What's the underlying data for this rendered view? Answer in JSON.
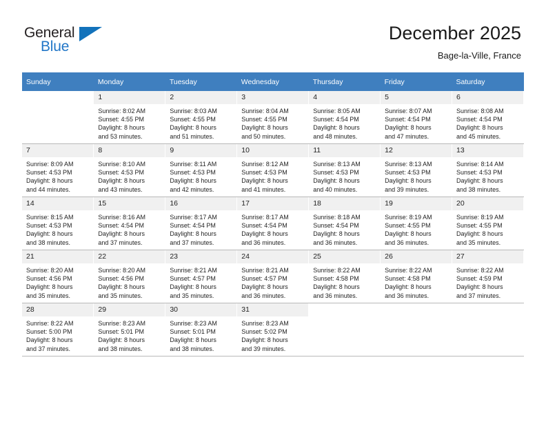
{
  "brand": {
    "name_top": "General",
    "name_bottom": "Blue",
    "accent_color": "#1272bb",
    "text_color": "#231f20"
  },
  "header": {
    "month_title": "December 2025",
    "location": "Bage-la-Ville, France"
  },
  "calendar": {
    "header_bg": "#3f7fbf",
    "weekdays": [
      "Sunday",
      "Monday",
      "Tuesday",
      "Wednesday",
      "Thursday",
      "Friday",
      "Saturday"
    ],
    "weeks": [
      [
        {
          "day": "",
          "sunrise": "",
          "sunset": "",
          "daylight1": "",
          "daylight2": "",
          "blank": true
        },
        {
          "day": "1",
          "sunrise": "Sunrise: 8:02 AM",
          "sunset": "Sunset: 4:55 PM",
          "daylight1": "Daylight: 8 hours",
          "daylight2": "and 53 minutes."
        },
        {
          "day": "2",
          "sunrise": "Sunrise: 8:03 AM",
          "sunset": "Sunset: 4:55 PM",
          "daylight1": "Daylight: 8 hours",
          "daylight2": "and 51 minutes."
        },
        {
          "day": "3",
          "sunrise": "Sunrise: 8:04 AM",
          "sunset": "Sunset: 4:55 PM",
          "daylight1": "Daylight: 8 hours",
          "daylight2": "and 50 minutes."
        },
        {
          "day": "4",
          "sunrise": "Sunrise: 8:05 AM",
          "sunset": "Sunset: 4:54 PM",
          "daylight1": "Daylight: 8 hours",
          "daylight2": "and 48 minutes."
        },
        {
          "day": "5",
          "sunrise": "Sunrise: 8:07 AM",
          "sunset": "Sunset: 4:54 PM",
          "daylight1": "Daylight: 8 hours",
          "daylight2": "and 47 minutes."
        },
        {
          "day": "6",
          "sunrise": "Sunrise: 8:08 AM",
          "sunset": "Sunset: 4:54 PM",
          "daylight1": "Daylight: 8 hours",
          "daylight2": "and 45 minutes."
        }
      ],
      [
        {
          "day": "7",
          "sunrise": "Sunrise: 8:09 AM",
          "sunset": "Sunset: 4:53 PM",
          "daylight1": "Daylight: 8 hours",
          "daylight2": "and 44 minutes."
        },
        {
          "day": "8",
          "sunrise": "Sunrise: 8:10 AM",
          "sunset": "Sunset: 4:53 PM",
          "daylight1": "Daylight: 8 hours",
          "daylight2": "and 43 minutes."
        },
        {
          "day": "9",
          "sunrise": "Sunrise: 8:11 AM",
          "sunset": "Sunset: 4:53 PM",
          "daylight1": "Daylight: 8 hours",
          "daylight2": "and 42 minutes."
        },
        {
          "day": "10",
          "sunrise": "Sunrise: 8:12 AM",
          "sunset": "Sunset: 4:53 PM",
          "daylight1": "Daylight: 8 hours",
          "daylight2": "and 41 minutes."
        },
        {
          "day": "11",
          "sunrise": "Sunrise: 8:13 AM",
          "sunset": "Sunset: 4:53 PM",
          "daylight1": "Daylight: 8 hours",
          "daylight2": "and 40 minutes."
        },
        {
          "day": "12",
          "sunrise": "Sunrise: 8:13 AM",
          "sunset": "Sunset: 4:53 PM",
          "daylight1": "Daylight: 8 hours",
          "daylight2": "and 39 minutes."
        },
        {
          "day": "13",
          "sunrise": "Sunrise: 8:14 AM",
          "sunset": "Sunset: 4:53 PM",
          "daylight1": "Daylight: 8 hours",
          "daylight2": "and 38 minutes."
        }
      ],
      [
        {
          "day": "14",
          "sunrise": "Sunrise: 8:15 AM",
          "sunset": "Sunset: 4:53 PM",
          "daylight1": "Daylight: 8 hours",
          "daylight2": "and 38 minutes."
        },
        {
          "day": "15",
          "sunrise": "Sunrise: 8:16 AM",
          "sunset": "Sunset: 4:54 PM",
          "daylight1": "Daylight: 8 hours",
          "daylight2": "and 37 minutes."
        },
        {
          "day": "16",
          "sunrise": "Sunrise: 8:17 AM",
          "sunset": "Sunset: 4:54 PM",
          "daylight1": "Daylight: 8 hours",
          "daylight2": "and 37 minutes."
        },
        {
          "day": "17",
          "sunrise": "Sunrise: 8:17 AM",
          "sunset": "Sunset: 4:54 PM",
          "daylight1": "Daylight: 8 hours",
          "daylight2": "and 36 minutes."
        },
        {
          "day": "18",
          "sunrise": "Sunrise: 8:18 AM",
          "sunset": "Sunset: 4:54 PM",
          "daylight1": "Daylight: 8 hours",
          "daylight2": "and 36 minutes."
        },
        {
          "day": "19",
          "sunrise": "Sunrise: 8:19 AM",
          "sunset": "Sunset: 4:55 PM",
          "daylight1": "Daylight: 8 hours",
          "daylight2": "and 36 minutes."
        },
        {
          "day": "20",
          "sunrise": "Sunrise: 8:19 AM",
          "sunset": "Sunset: 4:55 PM",
          "daylight1": "Daylight: 8 hours",
          "daylight2": "and 35 minutes."
        }
      ],
      [
        {
          "day": "21",
          "sunrise": "Sunrise: 8:20 AM",
          "sunset": "Sunset: 4:56 PM",
          "daylight1": "Daylight: 8 hours",
          "daylight2": "and 35 minutes."
        },
        {
          "day": "22",
          "sunrise": "Sunrise: 8:20 AM",
          "sunset": "Sunset: 4:56 PM",
          "daylight1": "Daylight: 8 hours",
          "daylight2": "and 35 minutes."
        },
        {
          "day": "23",
          "sunrise": "Sunrise: 8:21 AM",
          "sunset": "Sunset: 4:57 PM",
          "daylight1": "Daylight: 8 hours",
          "daylight2": "and 35 minutes."
        },
        {
          "day": "24",
          "sunrise": "Sunrise: 8:21 AM",
          "sunset": "Sunset: 4:57 PM",
          "daylight1": "Daylight: 8 hours",
          "daylight2": "and 36 minutes."
        },
        {
          "day": "25",
          "sunrise": "Sunrise: 8:22 AM",
          "sunset": "Sunset: 4:58 PM",
          "daylight1": "Daylight: 8 hours",
          "daylight2": "and 36 minutes."
        },
        {
          "day": "26",
          "sunrise": "Sunrise: 8:22 AM",
          "sunset": "Sunset: 4:58 PM",
          "daylight1": "Daylight: 8 hours",
          "daylight2": "and 36 minutes."
        },
        {
          "day": "27",
          "sunrise": "Sunrise: 8:22 AM",
          "sunset": "Sunset: 4:59 PM",
          "daylight1": "Daylight: 8 hours",
          "daylight2": "and 37 minutes."
        }
      ],
      [
        {
          "day": "28",
          "sunrise": "Sunrise: 8:22 AM",
          "sunset": "Sunset: 5:00 PM",
          "daylight1": "Daylight: 8 hours",
          "daylight2": "and 37 minutes."
        },
        {
          "day": "29",
          "sunrise": "Sunrise: 8:23 AM",
          "sunset": "Sunset: 5:01 PM",
          "daylight1": "Daylight: 8 hours",
          "daylight2": "and 38 minutes."
        },
        {
          "day": "30",
          "sunrise": "Sunrise: 8:23 AM",
          "sunset": "Sunset: 5:01 PM",
          "daylight1": "Daylight: 8 hours",
          "daylight2": "and 38 minutes."
        },
        {
          "day": "31",
          "sunrise": "Sunrise: 8:23 AM",
          "sunset": "Sunset: 5:02 PM",
          "daylight1": "Daylight: 8 hours",
          "daylight2": "and 39 minutes."
        },
        {
          "day": "",
          "sunrise": "",
          "sunset": "",
          "daylight1": "",
          "daylight2": "",
          "blank": true
        },
        {
          "day": "",
          "sunrise": "",
          "sunset": "",
          "daylight1": "",
          "daylight2": "",
          "blank": true
        },
        {
          "day": "",
          "sunrise": "",
          "sunset": "",
          "daylight1": "",
          "daylight2": "",
          "blank": true
        }
      ]
    ]
  }
}
